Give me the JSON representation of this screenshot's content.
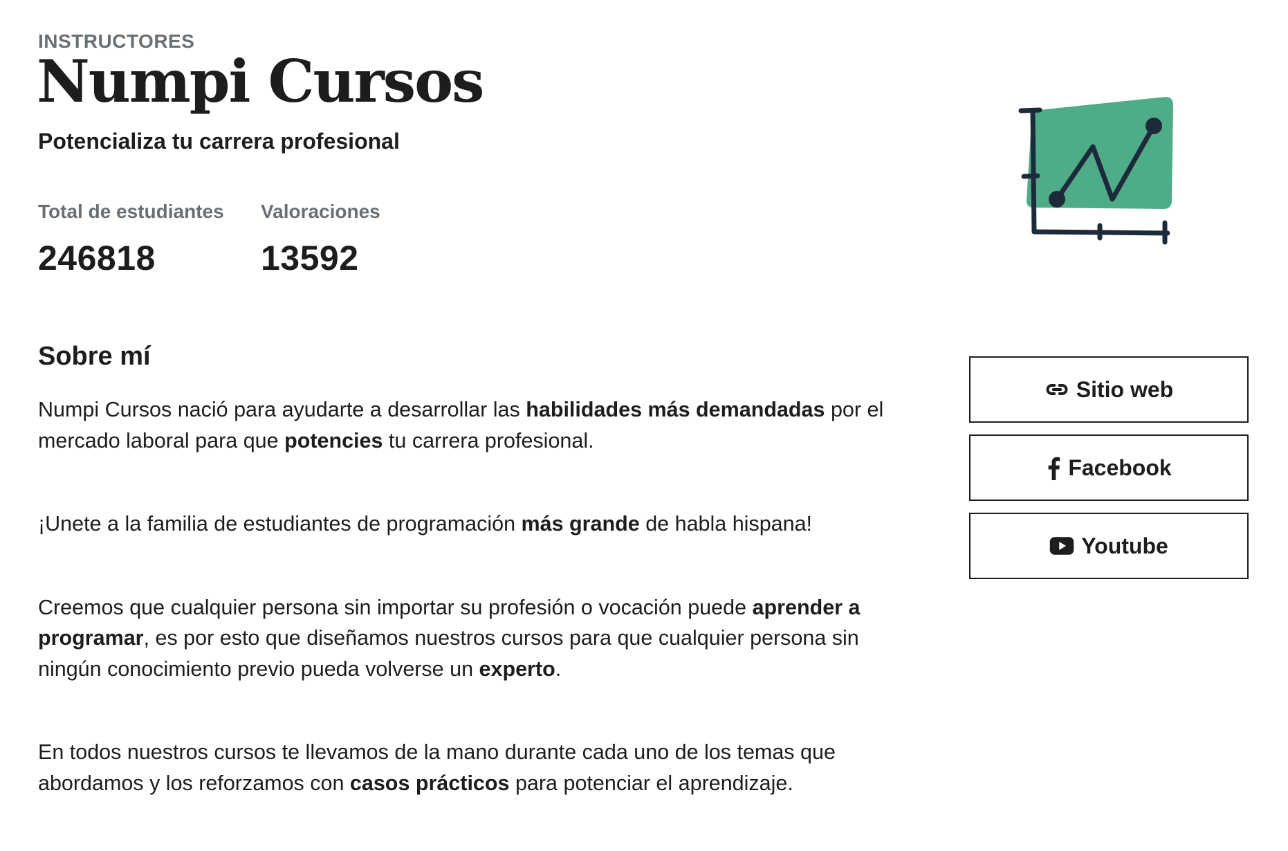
{
  "header": {
    "eyebrow": "INSTRUCTORES",
    "name": "Numpi Cursos",
    "headline": "Potencializa tu carrera profesional"
  },
  "stats": [
    {
      "label": "Total de estudiantes",
      "value": "246818"
    },
    {
      "label": "Valoraciones",
      "value": "13592"
    }
  ],
  "about": {
    "title": "Sobre mí",
    "paragraphs": [
      [
        {
          "text": "Numpi Cursos nació para ayudarte a desarrollar las ",
          "bold": false
        },
        {
          "text": "habilidades más demandadas",
          "bold": true
        },
        {
          "text": " por el mercado laboral para que ",
          "bold": false
        },
        {
          "text": "potencies",
          "bold": true
        },
        {
          "text": " tu carrera profesional.",
          "bold": false
        }
      ],
      [
        {
          "text": "¡Unete a la familia de estudiantes de programación ",
          "bold": false
        },
        {
          "text": "más grande",
          "bold": true
        },
        {
          "text": " de habla hispana!",
          "bold": false
        }
      ],
      [
        {
          "text": "Creemos que cualquier persona sin importar su profesión o vocación puede ",
          "bold": false
        },
        {
          "text": "aprender a programar",
          "bold": true
        },
        {
          "text": ", es por esto que diseñamos nuestros cursos para que cualquier persona sin ningún conocimiento previo pueda volverse un ",
          "bold": false
        },
        {
          "text": "experto",
          "bold": true
        },
        {
          "text": ".",
          "bold": false
        }
      ],
      [
        {
          "text": "En todos nuestros cursos te llevamos de la mano durante cada uno de los temas que abordamos y los reforzamos con ",
          "bold": false
        },
        {
          "text": "casos prácticos",
          "bold": true
        },
        {
          "text": " para potenciar el aprendizaje.",
          "bold": false
        }
      ]
    ]
  },
  "links": [
    {
      "label": "Sitio web",
      "icon": "link-icon"
    },
    {
      "label": "Facebook",
      "icon": "facebook-icon"
    },
    {
      "label": "Youtube",
      "icon": "youtube-icon"
    }
  ],
  "logo": {
    "icon": "chart-line-icon",
    "colors": {
      "fill": "#4fac88",
      "stroke": "#1d2a3a"
    }
  }
}
